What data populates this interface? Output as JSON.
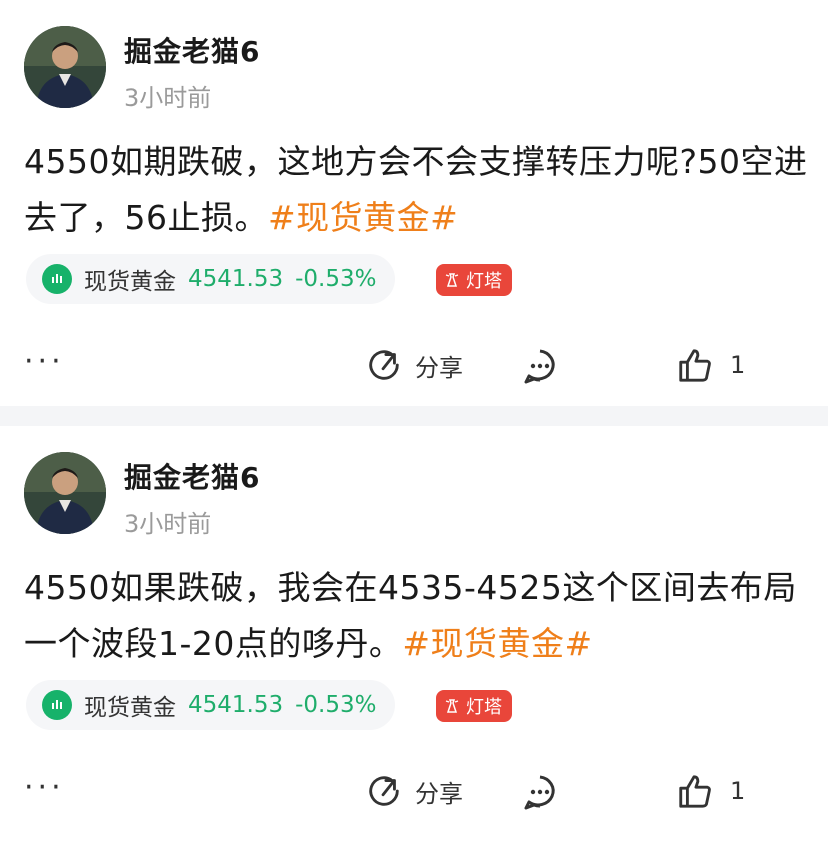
{
  "posts": [
    {
      "author": "掘金老猫6",
      "time": "3小时前",
      "text": "4550如期跌破，这地方会不会支撑转压力呢?50空进去了，56止损。",
      "hashtag": "#现货黄金#",
      "quote": {
        "name": "现货黄金",
        "price": "4541.53",
        "change": "-0.53%"
      },
      "badge": "灯塔",
      "actions": {
        "more": "···",
        "share": "分享",
        "likes": "1"
      }
    },
    {
      "author": "掘金老猫6",
      "time": "3小时前",
      "text": "4550如果跌破，我会在4535-4525这个区间去布局一个波段1-20点的哆丹。",
      "hashtag": "#现货黄金#",
      "quote": {
        "name": "现货黄金",
        "price": "4541.53",
        "change": "-0.53%"
      },
      "badge": "灯塔",
      "actions": {
        "more": "···",
        "share": "分享",
        "likes": "1"
      }
    }
  ],
  "colors": {
    "hashtag": "#ef7f1a",
    "quote_up_down": "#1fad6b",
    "badge_bg": "#e9463a",
    "separator": "#f4f5f7"
  }
}
